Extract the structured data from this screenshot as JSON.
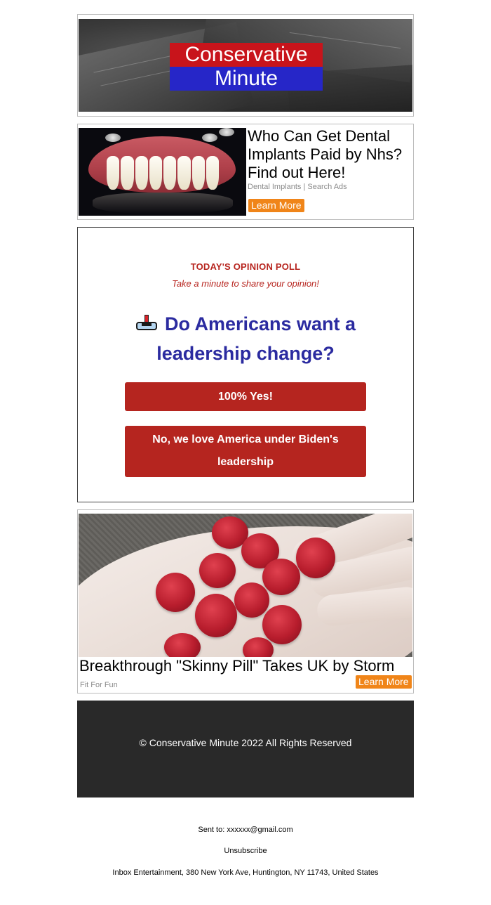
{
  "header": {
    "logo_line1": "Conservative",
    "logo_line2": "Minute",
    "colors": {
      "logo_red": "#c8141b",
      "logo_blue": "#2626c8"
    }
  },
  "ad_top": {
    "image_icon": "dental-implants-image",
    "title": "Who Can Get Dental Implants Paid by Nhs? Find out Here!",
    "source": "Dental Implants | Search Ads",
    "cta": "Learn More"
  },
  "poll": {
    "kicker": "TODAY'S OPINION POLL",
    "subtitle": "Take a minute to share your opinion!",
    "icon": "ballot-box-icon",
    "question": "Do Americans want a leadership change?",
    "options": [
      "100% Yes!",
      "No, we love America under Biden's leadership"
    ],
    "colors": {
      "accent": "#b5251f",
      "question": "#2b2ba0"
    }
  },
  "ad_bottom": {
    "image_icon": "gummies-in-hand-image",
    "title": "Breakthrough \"Skinny Pill\" Takes UK by Storm",
    "source": "Fit For Fun",
    "cta": "Learn More",
    "colors": {
      "cta": "#f08519"
    }
  },
  "footer": {
    "copyright": "© Conservative Minute 2022 All Rights Reserved"
  },
  "meta": {
    "sent_to": "Sent to: xxxxxx@gmail.com",
    "unsubscribe": "Unsubscribe",
    "address": "Inbox Entertainment, 380 New York Ave, Huntington, NY 11743, United States"
  }
}
